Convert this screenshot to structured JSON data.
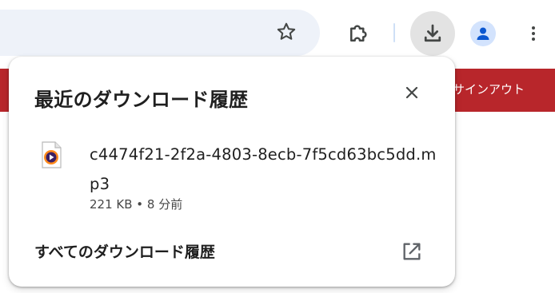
{
  "banner": {
    "signout_label": "サインアウト"
  },
  "downloads_bubble": {
    "title": "最近のダウンロード履歴",
    "item": {
      "filename": "c4474f21-2f2a-4803-8ecb-7f5cd63bc5dd.mp3",
      "meta": "221 KB • 8 分前"
    },
    "all_history_label": "すべてのダウンロード履歴"
  },
  "colors": {
    "banner": "#b8262b",
    "omnibox": "#eef2f9",
    "active_button": "#e3e3e3",
    "avatar_bg": "#d3e3fd",
    "avatar_fg": "#0b57d0"
  },
  "icons": [
    "star-icon",
    "extensions-icon",
    "download-icon",
    "profile-icon",
    "more-menu-icon",
    "close-icon",
    "audio-file-icon",
    "open-external-icon"
  ]
}
